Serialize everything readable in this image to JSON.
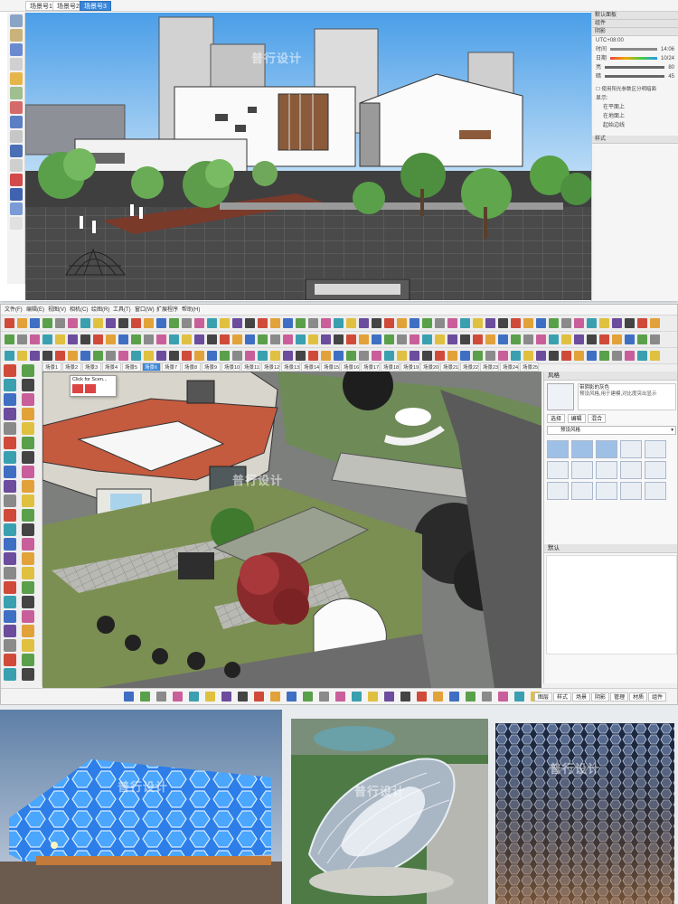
{
  "panel1": {
    "tabs": [
      "场景号1",
      "场景号2",
      "场景号3"
    ],
    "active_tab_index": 2,
    "tray": {
      "sections": [
        "默认面板",
        "组件",
        "阴影",
        "样式"
      ],
      "time_label": "时间",
      "date_label": "日期",
      "light_label": "亮",
      "dark_label": "暗",
      "utc_value": "UTC+08:00",
      "time_value": "14:06",
      "date_value": "10/24",
      "light_value": "80",
      "dark_value": "45",
      "checkbox_label": "使用阳光参数区分明暗面",
      "display_label": "显示:",
      "options": [
        "在平面上",
        "在地面上",
        "起始边线"
      ]
    },
    "watermark": "普行设计"
  },
  "panel2": {
    "menus": [
      "文件(F)",
      "编辑(E)",
      "视图(V)",
      "相机(C)",
      "绘图(R)",
      "工具(T)",
      "窗口(W)",
      "扩展程序",
      "帮助(H)"
    ],
    "scene_tabs": [
      "场景1",
      "场景2",
      "场景3",
      "场景4",
      "场景5",
      "场景6",
      "场景7",
      "场景8",
      "场景9",
      "场景10",
      "场景11",
      "场景12",
      "场景13",
      "场景14",
      "场景15",
      "场景16",
      "场景17",
      "场景18",
      "场景19",
      "场景20",
      "场景21",
      "场景22",
      "场景23",
      "场景24",
      "场景25"
    ],
    "active_scene_index": 5,
    "popup_title": "Click for Scen...",
    "right_panel": {
      "title": "风格",
      "style_name": "带阴影的灰色",
      "description": "预设风格,用于建模,对比度突出显示",
      "tabs": [
        "选择",
        "编辑",
        "混合"
      ],
      "dropdown": "预设风格",
      "sub_title": "默认"
    },
    "status_tabs": [
      "图层",
      "样式",
      "场景",
      "阴影",
      "管理",
      "材质",
      "组件"
    ],
    "watermark": "普行设计"
  },
  "photos": {
    "watermark1": "普行设计",
    "watermark2": "普行设计",
    "watermark3": "普行设计"
  }
}
